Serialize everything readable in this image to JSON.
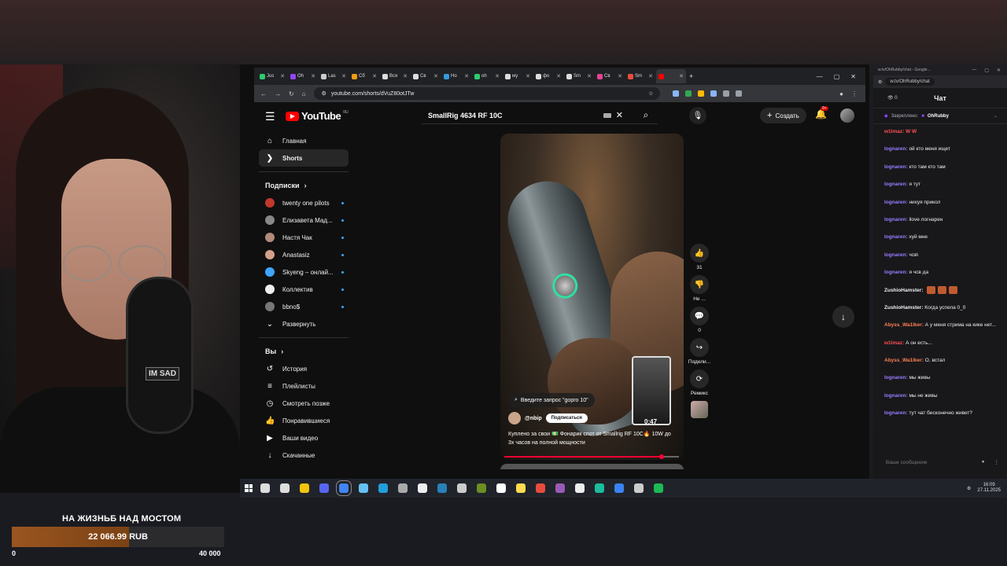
{
  "browser": {
    "tabs": [
      {
        "label": "Jus",
        "color": "#2ecc71"
      },
      {
        "label": "Oh",
        "color": "#9146ff"
      },
      {
        "label": "Las",
        "color": "#ccc"
      },
      {
        "label": "Сб",
        "color": "#f39c12"
      },
      {
        "label": "Вся",
        "color": "#ddd"
      },
      {
        "label": "Св",
        "color": "#ddd"
      },
      {
        "label": "Но",
        "color": "#3498db"
      },
      {
        "label": "oh",
        "color": "#2ecc71"
      },
      {
        "label": "му",
        "color": "#ddd"
      },
      {
        "label": "фо",
        "color": "#ddd"
      },
      {
        "label": "Sm",
        "color": "#ddd"
      },
      {
        "label": "Св",
        "color": "#e84393"
      },
      {
        "label": "Sm",
        "color": "#e74c3c"
      },
      {
        "label": "",
        "color": "#ff0000"
      }
    ],
    "new_tab": "+",
    "window_controls": [
      "—",
      "▢",
      "✕"
    ],
    "url": "youtube.com/shorts/dVuZ80otJTw"
  },
  "youtube": {
    "logo_text": "YouTube",
    "logo_region": "RU",
    "search_value": "SmallRig 4634 RF 10C",
    "create_label": "Создать",
    "notif_count": "9+",
    "nav": [
      {
        "label": "Главная",
        "icon": "home-icon",
        "glyph": "⌂"
      },
      {
        "label": "Shorts",
        "icon": "shorts-icon",
        "glyph": "❯"
      }
    ],
    "subs_header": "Подписки",
    "subscriptions": [
      {
        "label": "twenty one pilots",
        "color": "#c0392b"
      },
      {
        "label": "Елизавета Мад...",
        "color": "#888"
      },
      {
        "label": "Настя Чак",
        "color": "#b08a7a"
      },
      {
        "label": "Anastasiz",
        "color": "#d4a08a"
      },
      {
        "label": "Skyeng – онлай...",
        "color": "#3ea6ff"
      },
      {
        "label": "Коллектив",
        "color": "#eee"
      },
      {
        "label": "bbno$",
        "color": "#777"
      }
    ],
    "expand_label": "Развернуть",
    "you_header": "Вы",
    "you_items": [
      {
        "label": "История",
        "icon": "history-icon",
        "glyph": "↺"
      },
      {
        "label": "Плейлисты",
        "icon": "playlists-icon",
        "glyph": "≡"
      },
      {
        "label": "Смотреть позже",
        "icon": "watch-later-icon",
        "glyph": "◷"
      },
      {
        "label": "Понравившиеся",
        "icon": "like-icon",
        "glyph": "👍"
      },
      {
        "label": "Ваши видео",
        "icon": "your-videos-icon",
        "glyph": "▶"
      },
      {
        "label": "Скачанные",
        "icon": "download-icon",
        "glyph": "↓"
      }
    ],
    "short": {
      "search_chip": "Введите запрос \"gopro 10\"",
      "channel": "@nbip",
      "subscribe": "Подписаться",
      "description": "Куплено за свои 💵 Фонарик спот от Smallrig RF 10C🔥 10W  до 3х часов на полной мощности",
      "preview_time": "0:47",
      "progress": 0.9
    },
    "actions": [
      {
        "icon": "like-icon",
        "glyph": "👍",
        "label": "31"
      },
      {
        "icon": "dislike-icon",
        "glyph": "👎",
        "label": "Не ..."
      },
      {
        "icon": "comments-icon",
        "glyph": "💬",
        "label": "0"
      },
      {
        "icon": "share-icon",
        "glyph": "↪",
        "label": "Подели..."
      },
      {
        "icon": "remix-icon",
        "glyph": "⟳",
        "label": "Ремикс"
      }
    ]
  },
  "taskbar": {
    "icons": [
      "#ddd",
      "#ddd",
      "#f1c40f",
      "#5865f2",
      "#4285f4",
      "#66c0f4",
      "#229ed9",
      "#aaa",
      "#eee",
      "#2980b9",
      "#ccc",
      "#6b8e23",
      "#fff",
      "#ffdb4d",
      "#e74c3c",
      "#9b59b6",
      "#eee",
      "#1abc9c",
      "#3b82f6",
      "#ccc",
      "#1db954"
    ],
    "time": "16:09",
    "date": "27.11.2025"
  },
  "chat": {
    "window_title": "w.tv/OhRubby/chat - Google...",
    "url": "w.tv/OhRubby/chat",
    "title": "Чат",
    "viewers": "0",
    "pinned_prefix": "Закреплено:",
    "pinned_user": "OhRubby",
    "messages": [
      {
        "user": "w1lmaz:",
        "text": "W  W",
        "color": "#ff4f4f",
        "emotes": 0
      },
      {
        "user": "lognaren:",
        "text": "ой кто меня ищет",
        "color": "#9b7dff",
        "emotes": 0
      },
      {
        "user": "lognaren:",
        "text": "кто там кто там",
        "color": "#9b7dff",
        "emotes": 0
      },
      {
        "user": "lognaren:",
        "text": "я тут",
        "color": "#9b7dff",
        "emotes": 0
      },
      {
        "user": "lognaren:",
        "text": "нихуя прикол",
        "color": "#9b7dff",
        "emotes": 0
      },
      {
        "user": "lognaren:",
        "text": "ilove логнарен",
        "color": "#9b7dff",
        "emotes": 0
      },
      {
        "user": "lognaren:",
        "text": "хуй мне",
        "color": "#9b7dff",
        "emotes": 0
      },
      {
        "user": "lognaren:",
        "text": "чсв\\",
        "color": "#9b7dff",
        "emotes": 0
      },
      {
        "user": "lognaren:",
        "text": "я чсв да",
        "color": "#9b7dff",
        "emotes": 0
      },
      {
        "user": "ZushioHamster:",
        "text": "",
        "color": "#efeff1",
        "emotes": 3
      },
      {
        "user": "ZushioHamster:",
        "text": "Когда успела 0_0",
        "color": "#efeff1",
        "emotes": 0
      },
      {
        "user": "Abyss_Wa1lker:",
        "text": "А у меня стрима на кике нет...",
        "color": "#ff7f50",
        "emotes": 0
      },
      {
        "user": "w1lmaz:",
        "text": "А он есть...",
        "color": "#ff4f4f",
        "emotes": 0
      },
      {
        "user": "Abyss_Wa1lker:",
        "text": "О, встал",
        "color": "#ff7f50",
        "emotes": 0
      },
      {
        "user": "lognaren:",
        "text": "мы живы",
        "color": "#9b7dff",
        "emotes": 0
      },
      {
        "user": "lognaren:",
        "text": "мы не живы",
        "color": "#9b7dff",
        "emotes": 0
      },
      {
        "user": "lognaren:",
        "text": "тут чат бесконечно живет?",
        "color": "#9b7dff",
        "emotes": 0
      }
    ],
    "input_placeholder": "Ваше сообщение"
  },
  "stream": {
    "webcam_text": "IM SAD",
    "goal_title": "НА ЖИЗНЬБ НАД МОСТОМ",
    "goal_amount": "22 066.99 RUB",
    "goal_min": "0",
    "goal_max": "40 000",
    "goal_progress": 0.5517
  }
}
